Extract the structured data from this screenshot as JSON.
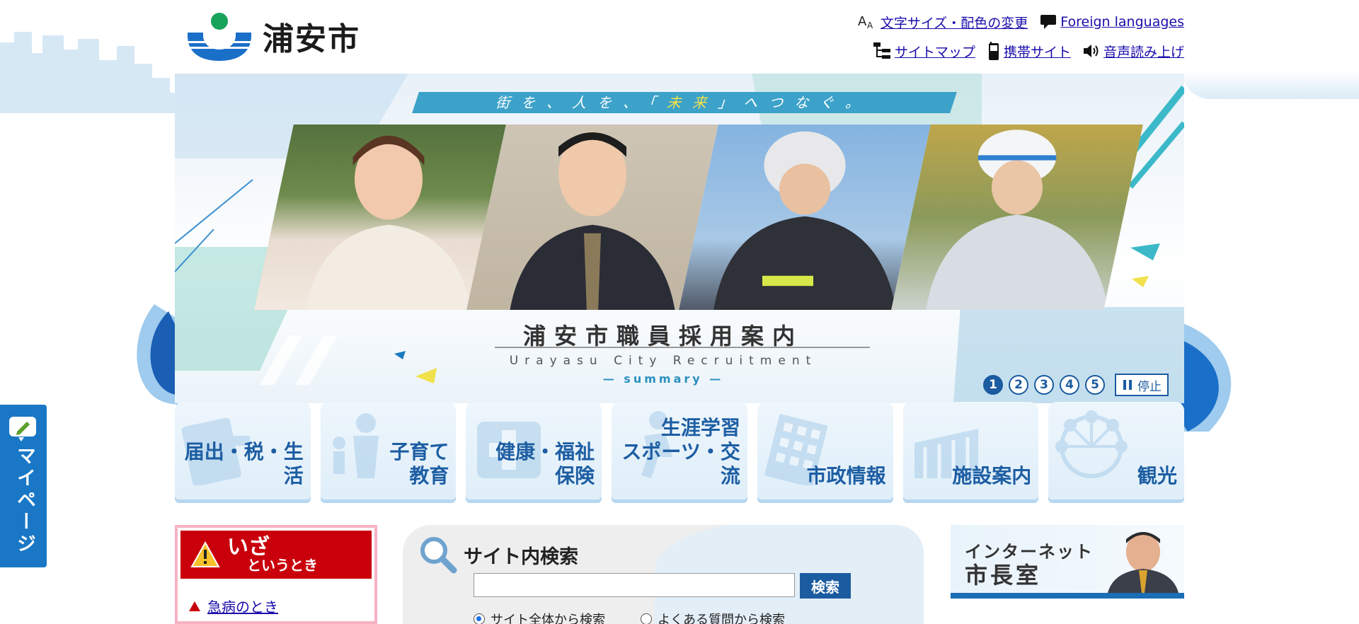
{
  "site": {
    "name": "浦安市"
  },
  "utility": {
    "row1": [
      {
        "label": "文字サイズ・配色の変更",
        "icon": "text-size-icon"
      },
      {
        "label": "Foreign languages",
        "icon": "speech-bubble-icon"
      }
    ],
    "row2": [
      {
        "label": "サイトマップ",
        "icon": "sitemap-icon"
      },
      {
        "label": "携帯サイト",
        "icon": "mobile-phone-icon"
      },
      {
        "label": "音声読み上げ",
        "icon": "speaker-icon"
      }
    ]
  },
  "hero": {
    "band_pre": "街を、人を、「",
    "band_hl": "未来",
    "band_post": "」へつなぐ。",
    "title": "浦安市職員採用案内",
    "subtitle": "Urayasu City Recruitment",
    "summary": "— summary —",
    "slides": [
      "1",
      "2",
      "3",
      "4",
      "5"
    ],
    "active_slide": 1,
    "stop_label": "停止"
  },
  "nav": [
    {
      "label": "届出・税・生活",
      "icon": "document-icon"
    },
    {
      "label": "子育て\n教育",
      "icon": "parent-child-icon"
    },
    {
      "label": "健康・福祉\n保険",
      "icon": "medical-cross-icon"
    },
    {
      "label": "生涯学習\nスポーツ・交流",
      "icon": "runner-icon"
    },
    {
      "label": "市政情報",
      "icon": "building-icon"
    },
    {
      "label": "施設案内",
      "icon": "facility-icon"
    },
    {
      "label": "観光",
      "icon": "ferris-wheel-icon"
    }
  ],
  "emergency": {
    "title1": "いざ",
    "title2": "というとき",
    "link1": "急病のとき"
  },
  "search": {
    "title": "サイト内検索",
    "input_value": "",
    "button": "検索",
    "radio1": "サイト全体から検索",
    "radio2": "よくある質問から検索",
    "selected": "radio1"
  },
  "mayor": {
    "line1": "インターネット",
    "line2": "市長室"
  },
  "mypage": {
    "label": "マイページ"
  },
  "colors": {
    "brand_blue": "#1b5ba0",
    "alert_red": "#c9000b",
    "link": "#1a0dab"
  }
}
